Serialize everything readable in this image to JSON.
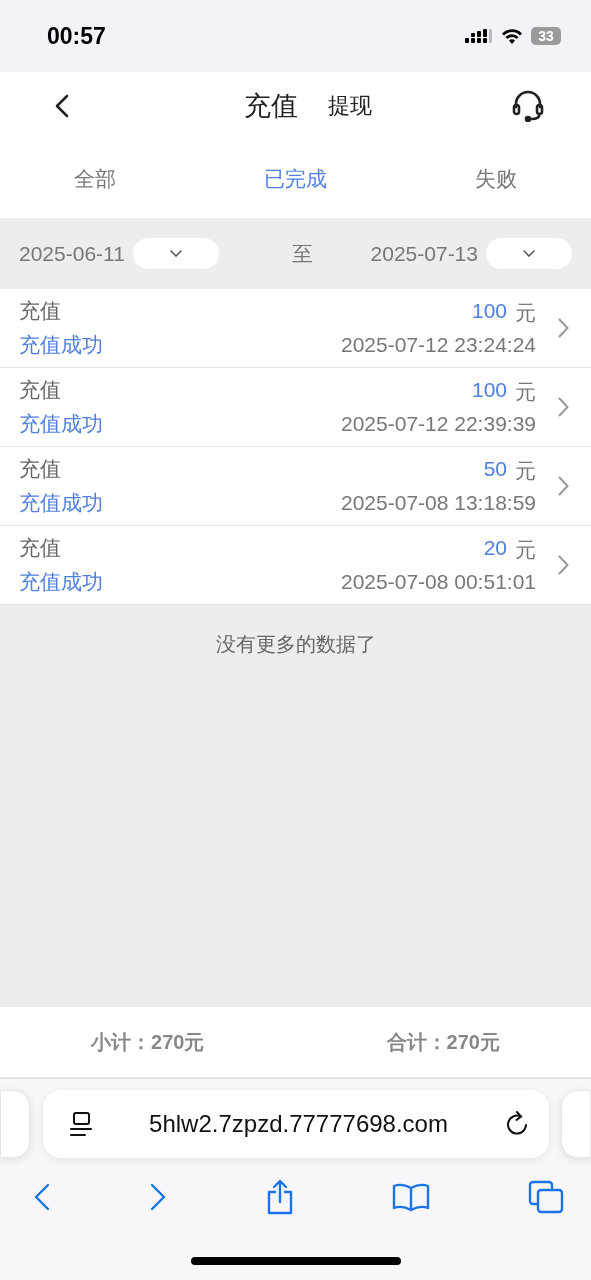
{
  "status_bar": {
    "time": "00:57",
    "battery": "33"
  },
  "header": {
    "tabs": [
      {
        "label": "充值",
        "selected": true
      },
      {
        "label": "提现",
        "selected": false
      }
    ]
  },
  "filters": [
    {
      "label": "全部",
      "selected": false
    },
    {
      "label": "已完成",
      "selected": true
    },
    {
      "label": "失败",
      "selected": false
    }
  ],
  "date_range": {
    "start": "2025-06-11",
    "separator": "至",
    "end": "2025-07-13"
  },
  "records": [
    {
      "type": "充值",
      "status": "充值成功",
      "amount": "100",
      "unit": "元",
      "time": "2025-07-12 23:24:24"
    },
    {
      "type": "充值",
      "status": "充值成功",
      "amount": "100",
      "unit": "元",
      "time": "2025-07-12 22:39:39"
    },
    {
      "type": "充值",
      "status": "充值成功",
      "amount": "50",
      "unit": "元",
      "time": "2025-07-08 13:18:59"
    },
    {
      "type": "充值",
      "status": "充值成功",
      "amount": "20",
      "unit": "元",
      "time": "2025-07-08 00:51:01"
    }
  ],
  "end_message": "没有更多的数据了",
  "totals": {
    "subtotal": "小计：270元",
    "total": "合计：270元"
  },
  "browser": {
    "url": "5hlw2.7zpzd.77777698.com"
  }
}
